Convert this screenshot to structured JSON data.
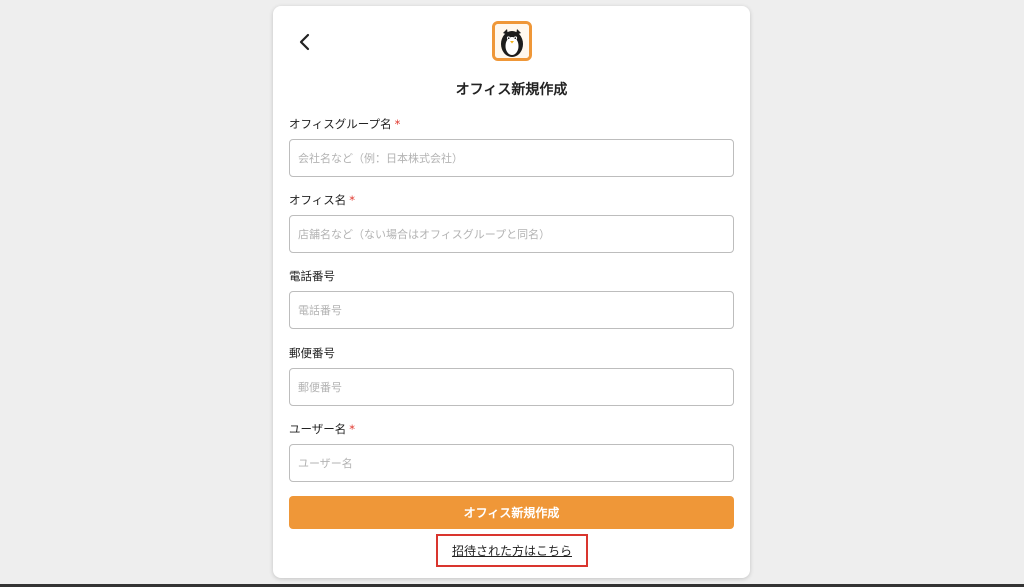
{
  "header": {
    "title": "オフィス新規作成"
  },
  "form": {
    "fields": [
      {
        "label": "オフィスグループ名",
        "required_mark": "*",
        "placeholder": "会社名など（例：日本株式会社）",
        "value": ""
      },
      {
        "label": "オフィス名",
        "required_mark": "*",
        "placeholder": "店舗名など（ない場合はオフィスグループと同名）",
        "value": ""
      },
      {
        "label": "電話番号",
        "required_mark": "",
        "placeholder": "電話番号",
        "value": ""
      },
      {
        "label": "郵便番号",
        "required_mark": "",
        "placeholder": "郵便番号",
        "value": ""
      },
      {
        "label": "ユーザー名",
        "required_mark": "*",
        "placeholder": "ユーザー名",
        "value": ""
      }
    ],
    "submit_label": "オフィス新規作成",
    "invite_link_label": "招待された方はこちら"
  },
  "icons": {
    "back": "chevron-left-icon",
    "logo": "penguin-logo-icon"
  },
  "colors": {
    "accent": "#ef9738",
    "required": "#e0352b",
    "highlight_border": "#d9352e"
  }
}
